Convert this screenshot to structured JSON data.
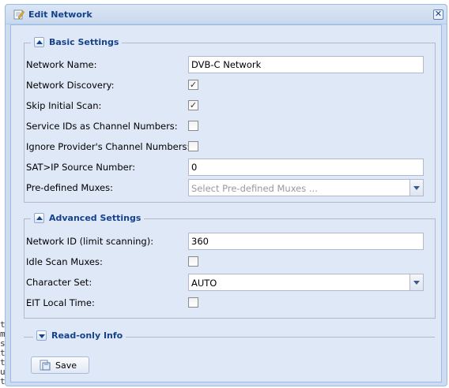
{
  "window": {
    "title": "Edit Network",
    "close_glyph": "✕"
  },
  "basic": {
    "legend": "Basic Settings",
    "network_name_label": "Network Name:",
    "network_name_value": "DVB-C Network",
    "network_discovery_label": "Network Discovery:",
    "network_discovery_checked": true,
    "skip_initial_scan_label": "Skip Initial Scan:",
    "skip_initial_scan_checked": true,
    "service_ids_label": "Service IDs as Channel Numbers:",
    "service_ids_checked": false,
    "ignore_provider_label": "Ignore Provider's Channel Numbers:",
    "ignore_provider_checked": false,
    "satip_label": "SAT>IP Source Number:",
    "satip_value": "0",
    "muxes_label": "Pre-defined Muxes:",
    "muxes_placeholder": "Select Pre-defined Muxes ..."
  },
  "advanced": {
    "legend": "Advanced Settings",
    "network_id_label": "Network ID (limit scanning):",
    "network_id_value": "360",
    "idle_scan_label": "Idle Scan Muxes:",
    "idle_scan_checked": false,
    "charset_label": "Character Set:",
    "charset_value": "AUTO",
    "eit_label": "EIT Local Time:",
    "eit_checked": false
  },
  "readonly": {
    "legend": "Read-only Info"
  },
  "footer": {
    "save_label": "Save"
  },
  "background_text": [
    "t",
    "m",
    "",
    "s",
    "t",
    "t",
    "u",
    "t"
  ],
  "checkbox_glyph": "✓"
}
